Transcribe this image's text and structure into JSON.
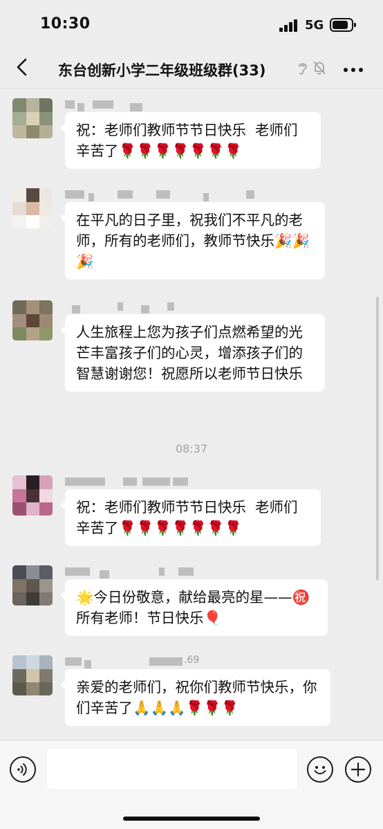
{
  "status_bar": {
    "time": "10:30",
    "network": "5G"
  },
  "nav": {
    "title": "东台创新小学二年级班级群(33)",
    "back_icon": "chevron-left-icon",
    "ear_icon": "ear-icon",
    "mute_icon": "bell-muted-icon",
    "more_icon": "more-horizontal-icon"
  },
  "messages": [
    {
      "text": "祝：老师们教师节节日快乐  老师们辛苦了🌹🌹🌹🌹🌹🌹🌹"
    },
    {
      "text": "在平凡的日子里，祝我们不平凡的老师，所有的老师们，教师节快乐🎉🎉🎉"
    },
    {
      "text": "人生旅程上您为孩子们点燃希望的光芒丰富孩子们的心灵，增添孩子们的智慧谢谢您！祝愿所以老师节日快乐"
    },
    {
      "text": "祝：老师们教师节节日快乐  老师们辛苦了🌹🌹🌹🌹🌹🌹🌹"
    },
    {
      "text": "🌟今日份敬意，献给最亮的星——㊗️所有老师！节日快乐🎈"
    },
    {
      "sender_suffix": ".69",
      "text": "亲爱的老师们，祝你们教师节快乐，你们辛苦了🙏🙏🙏🌹🌹🌹"
    }
  ],
  "timestamp": "08:37",
  "input_bar": {
    "voice_icon": "voice-icon",
    "emoji_icon": "smiley-icon",
    "plus_icon": "plus-icon"
  },
  "colors": {
    "background": "#ededed",
    "bubble": "#ffffff",
    "input_bar": "#f6f6f6",
    "blur": "#bdbdbd"
  }
}
